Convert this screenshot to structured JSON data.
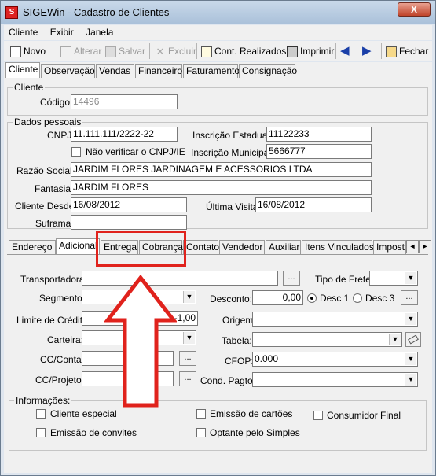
{
  "window": {
    "title": "SIGEWin - Cadastro de Clientes",
    "close_label": "X",
    "app_icon": "S"
  },
  "menu": [
    "Cliente",
    "Exibir",
    "Janela"
  ],
  "toolbar": {
    "novo": "Novo",
    "alterar": "Alterar",
    "salvar": "Salvar",
    "excluir": "Excluir",
    "cont_realizados": "Cont. Realizados",
    "imprimir": "Imprimir",
    "fechar": "Fechar"
  },
  "top_tabs": [
    "Cliente",
    "Observação",
    "Vendas",
    "Financeiro",
    "Faturamento",
    "Consignação"
  ],
  "cliente_group": {
    "title": "Cliente",
    "codigo_label": "Código:",
    "codigo": "14496"
  },
  "dados": {
    "title": "Dados pessoais",
    "cnpj_label": "CNPJ",
    "cnpj": "11.111.111/2222-22",
    "nao_verificar": "Não verificar o CNPJ/IE",
    "ie_label": "Inscrição Estadual",
    "ie": "11122233",
    "im_label": "Inscrição Municipal",
    "im": "5666777",
    "razao_label": "Razão Social",
    "razao": "JARDIM FLORES JARDINAGEM E ACESSORIOS LTDA",
    "fantasia_label": "Fantasia",
    "fantasia": "JARDIM FLORES",
    "desde_label": "Cliente Desde",
    "desde": "16/08/2012",
    "ultima_label": "Última Visita",
    "ultima": "16/08/2012",
    "suframa_label": "Suframa",
    "suframa": ""
  },
  "sub_tabs": [
    "Endereço",
    "Adicional",
    "Entrega",
    "Cobrança",
    "Contato",
    "Vendedor",
    "Auxiliar",
    "Itens Vinculados",
    "Imposto"
  ],
  "scroll_left": "◄",
  "scroll_right": "►",
  "adicional": {
    "transportadora_label": "Transportadora:",
    "transportadora": "",
    "tipo_frete_label": "Tipo de Frete:",
    "tipo_frete": "",
    "segmento_label": "Segmento:",
    "segmento": "",
    "desconto_label": "Desconto:",
    "desconto": "0,00",
    "desc1": "Desc 1",
    "desc3": "Desc 3",
    "limite_label": "Limite de Crédito:",
    "limite": "-1,00",
    "origem_label": "Origem:",
    "origem": "",
    "carteira_label": "Carteira:",
    "carteira": "",
    "tabela_label": "Tabela:",
    "tabela": "",
    "cc_conta_label": "CC/Conta:",
    "cc_conta": "",
    "cfop_label": "CFOP:",
    "cfop": "0.000",
    "cc_projeto_label": "CC/Projeto:",
    "cc_projeto": "",
    "cond_pagto_label": "Cond. Pagto:",
    "cond_pagto": "",
    "ellipsis": "...",
    "dropdown_arrow": "▼"
  },
  "informacoes": {
    "title": "Informações:",
    "cliente_especial": "Cliente especial",
    "emissao_cartoes": "Emissão de cartões",
    "consumidor_final": "Consumidor Final",
    "emissao_convites": "Emissão de convites",
    "optante_simples": "Optante pelo Simples"
  },
  "colors": {
    "highlight": "#e0221c",
    "title_bar": "#a9c0d9",
    "panel": "#f0f0f0"
  }
}
